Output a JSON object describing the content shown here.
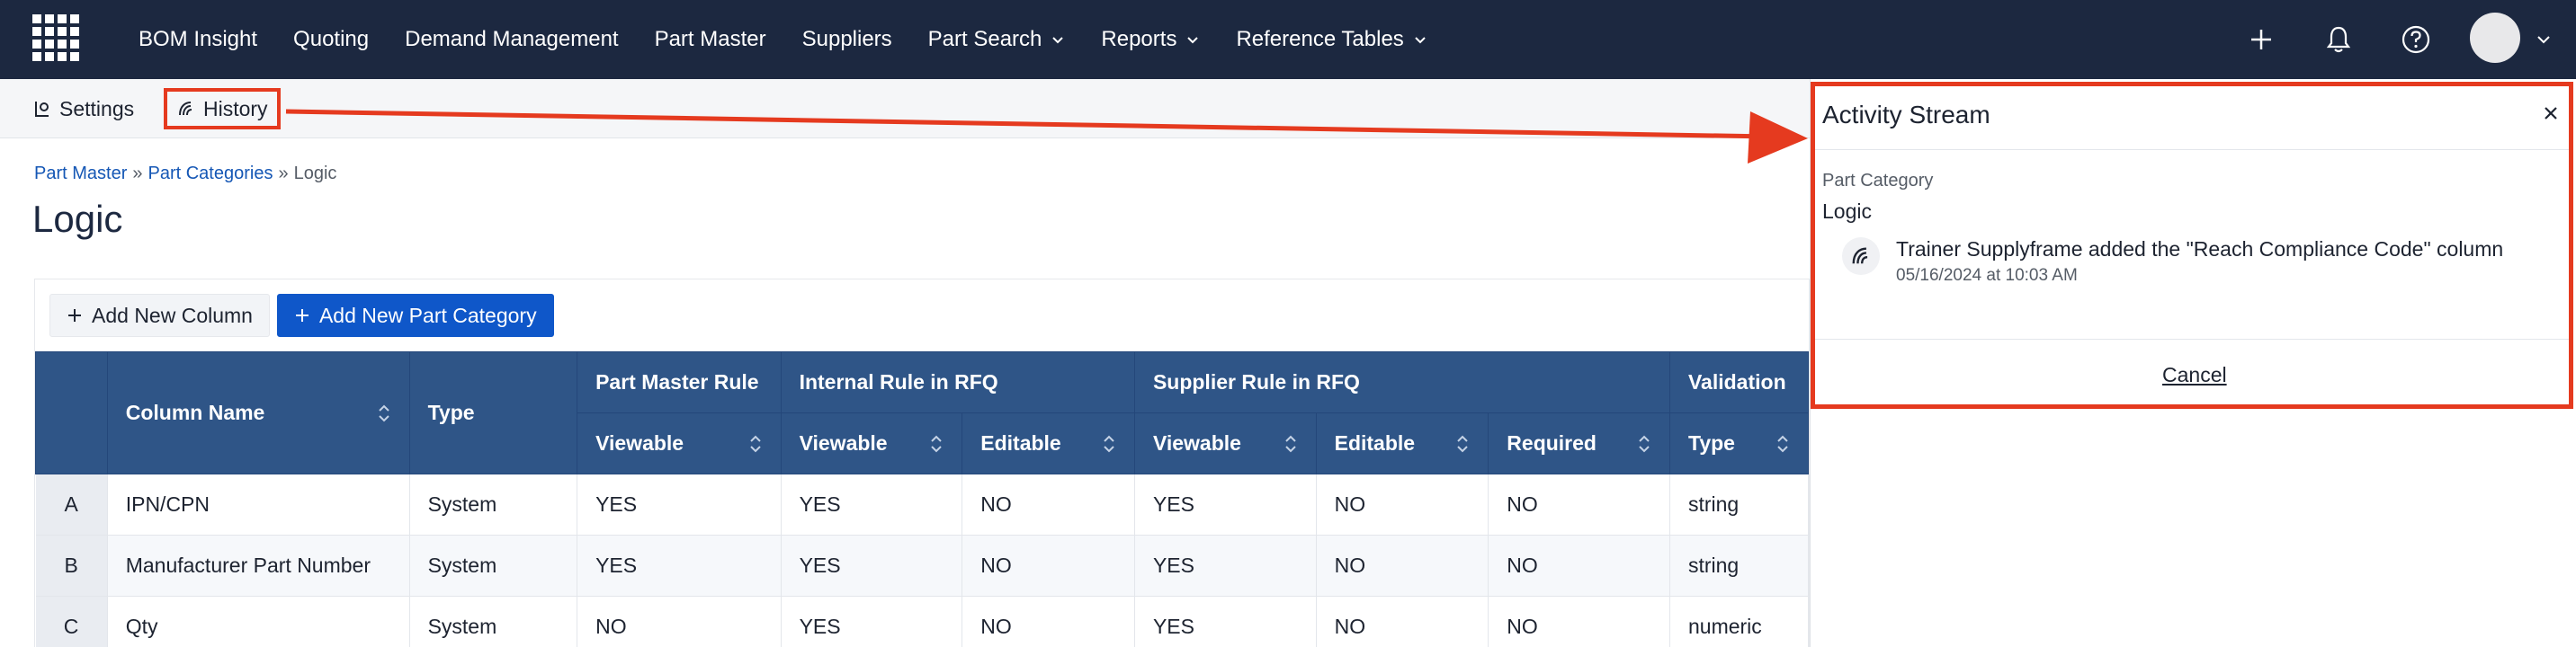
{
  "nav": {
    "items": [
      {
        "label": "BOM Insight",
        "dropdown": false
      },
      {
        "label": "Quoting",
        "dropdown": false
      },
      {
        "label": "Demand Management",
        "dropdown": false
      },
      {
        "label": "Part Master",
        "dropdown": false
      },
      {
        "label": "Suppliers",
        "dropdown": false
      },
      {
        "label": "Part Search",
        "dropdown": true
      },
      {
        "label": "Reports",
        "dropdown": true
      },
      {
        "label": "Reference Tables",
        "dropdown": true
      }
    ],
    "icons": [
      "plus-icon",
      "bell-icon",
      "help-icon"
    ],
    "colors": {
      "background": "#1c2840"
    }
  },
  "subbar": {
    "settings_label": "Settings",
    "history_label": "History"
  },
  "breadcrumb": {
    "items": [
      "Part Master",
      "Part Categories",
      "Logic"
    ],
    "separator": "»"
  },
  "page": {
    "title": "Logic"
  },
  "actions": {
    "add_column": "Add New Column",
    "add_category": "Add New Part Category"
  },
  "table": {
    "groups": {
      "part_master": "Part Master Rule",
      "internal": "Internal Rule in RFQ",
      "supplier": "Supplier Rule in RFQ",
      "validation": "Validation"
    },
    "headers": {
      "column_name": "Column Name",
      "type": "Type",
      "pm_viewable": "Viewable",
      "int_viewable": "Viewable",
      "int_editable": "Editable",
      "sup_viewable": "Viewable",
      "sup_editable": "Editable",
      "sup_required": "Required",
      "val_type": "Type"
    },
    "rows": [
      {
        "idx": "A",
        "name": "IPN/CPN",
        "type": "System",
        "pm_viewable": "YES",
        "int_viewable": "YES",
        "int_editable": "NO",
        "sup_viewable": "YES",
        "sup_editable": "NO",
        "sup_required": "NO",
        "val_type": "string"
      },
      {
        "idx": "B",
        "name": "Manufacturer Part Number",
        "type": "System",
        "pm_viewable": "YES",
        "int_viewable": "YES",
        "int_editable": "NO",
        "sup_viewable": "YES",
        "sup_editable": "NO",
        "sup_required": "NO",
        "val_type": "string"
      },
      {
        "idx": "C",
        "name": "Qty",
        "type": "System",
        "pm_viewable": "NO",
        "int_viewable": "YES",
        "int_editable": "NO",
        "sup_viewable": "YES",
        "sup_editable": "NO",
        "sup_required": "NO",
        "val_type": "numeric"
      }
    ],
    "colors": {
      "header": "#2f5587"
    }
  },
  "activity": {
    "title": "Activity Stream",
    "category_label": "Part Category",
    "category_value": "Logic",
    "entry_text": "Trainer Supplyframe added the \"Reach Compliance Code\" column",
    "entry_time": "05/16/2024 at 10:03 AM",
    "cancel_label": "Cancel",
    "highlight_color": "#e53a1f"
  }
}
